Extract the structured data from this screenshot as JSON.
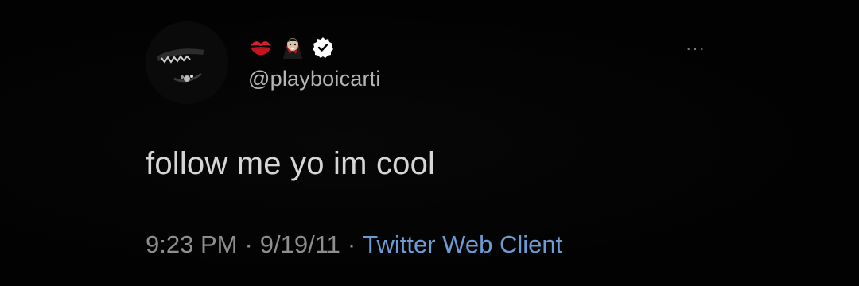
{
  "tweet": {
    "display_name_emojis": [
      "kiss-mark",
      "vampire"
    ],
    "verified": true,
    "handle": "@playboicarti",
    "more_glyph": "···",
    "text": "follow me yo im cool",
    "time": "9:23 PM",
    "date": "9/19/11",
    "separator": "·",
    "source": "Twitter Web Client"
  },
  "colors": {
    "background": "#030303",
    "source_link": "#6d9bd6",
    "meta_text": "#8e8e8e",
    "verified_badge": "#ffffff"
  }
}
